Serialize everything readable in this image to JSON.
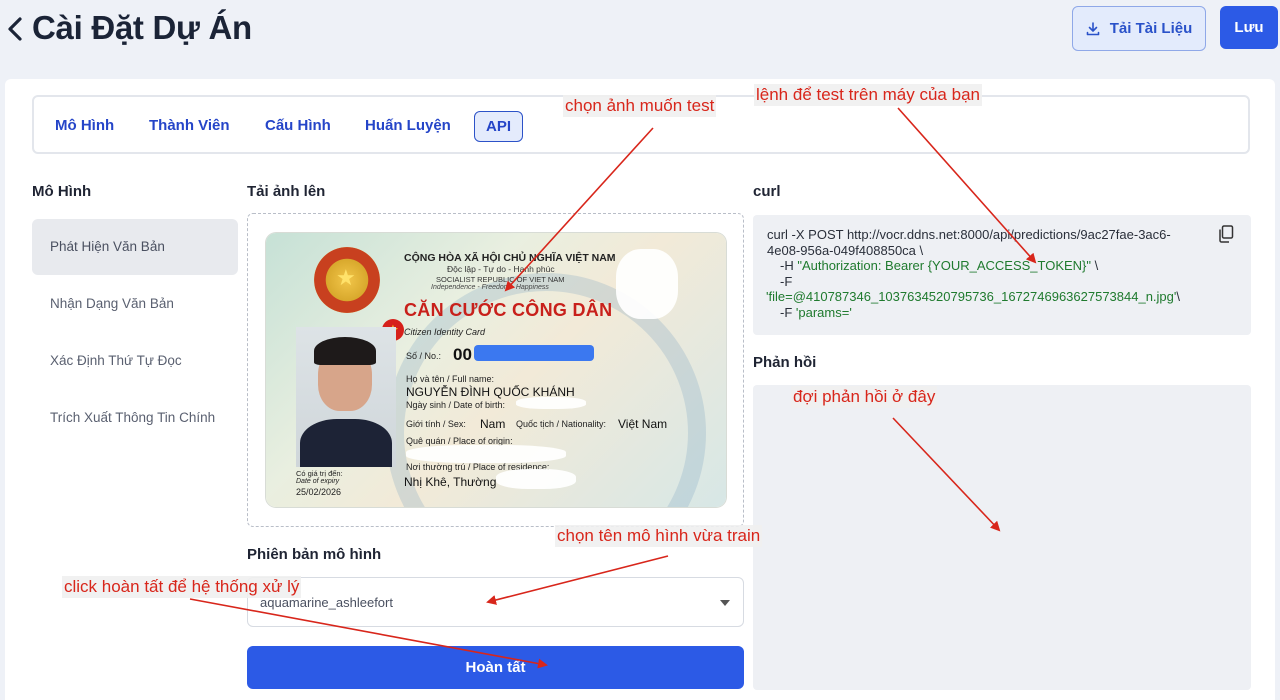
{
  "header": {
    "title": "Cài Đặt Dự Án",
    "download_label": "Tải Tài Liệu",
    "save_label": "Lưu"
  },
  "tabs": [
    {
      "label": "Mô Hình"
    },
    {
      "label": "Thành Viên"
    },
    {
      "label": "Cấu Hình"
    },
    {
      "label": "Huấn Luyện"
    },
    {
      "label": "API",
      "active": true
    }
  ],
  "sidebar": {
    "heading": "Mô Hình",
    "items": [
      {
        "label": "Phát Hiện Văn Bản",
        "active": true
      },
      {
        "label": "Nhận Dạng Văn Bản"
      },
      {
        "label": "Xác Định Thứ Tự Đọc"
      },
      {
        "label": "Trích Xuất Thông Tin Chính"
      }
    ]
  },
  "upload": {
    "heading": "Tải ảnh lên",
    "card": {
      "nation": "CỘNG HÒA XÃ HỘI CHỦ NGHĨA VIỆT NAM",
      "motto": "Độc lập - Tự do - Hạnh phúc",
      "nation_en": "SOCIALIST REPUBLIC OF VIET NAM",
      "motto_en": "Independence - Freedom - Happiness",
      "title": "CĂN CƯỚC CÔNG DÂN",
      "subtitle": "Citizen Identity Card",
      "no_label": "Số / No.:",
      "no_value": "00",
      "name_label": "Họ và tên / Full name:",
      "name_value": "NGUYỄN ĐÌNH QUỐC KHÁNH",
      "dob_label": "Ngày sinh / Date of birth:",
      "sex_label": "Giới tính / Sex:",
      "sex_value": "Nam",
      "nationality_label": "Quốc tịch / Nationality:",
      "nationality_value": "Việt Nam",
      "origin_label": "Quê quán / Place of origin:",
      "residence_label": "Nơi thường trú / Place of residence:",
      "residence_value": "Nhị Khê, Thường",
      "expiry_label": "Có giá trị đến:",
      "expiry_label_en": "Date of expiry",
      "expiry_value": "25/02/2026"
    }
  },
  "model_version": {
    "heading": "Phiên bản mô hình",
    "selected": "aquamarine_ashleefort"
  },
  "submit_label": "Hoàn tất",
  "curl": {
    "heading": "curl",
    "line1": "curl -X POST http://vocr.ddns.net:8000/api/predictions/9ac27fae-3ac6-",
    "line2": "4e08-956a-049f408850ca \\",
    "line3a": "-H ",
    "line3b": "\"Authorization: Bearer {YOUR_ACCESS_TOKEN}\"",
    "line3c": " \\",
    "line4": "-F",
    "line5a": "'file=@410787346_1037634520795736_1672746963627573844_n.jpg'",
    "line5b": "\\",
    "line6a": "-F ",
    "line6b": "'params='"
  },
  "response": {
    "heading": "Phản hồi"
  },
  "annotations": {
    "choose_image": "chọn ảnh muốn test",
    "command": "lệnh để test trên máy của bạn",
    "wait_response": "đợi phản hồi ở đây",
    "choose_model": "chọn tên mô hình vừa train",
    "click_done": "click hoàn tất để hệ thống xử lý"
  },
  "colors": {
    "primary": "#2c5ae6",
    "annotation": "#d8261b",
    "code_string": "#1f7a2e"
  }
}
